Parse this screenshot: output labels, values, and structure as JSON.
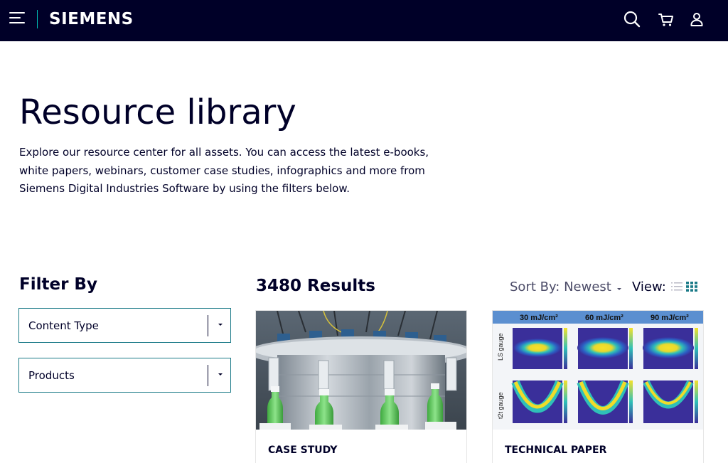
{
  "header": {
    "logo": "SIEMENS",
    "icons": [
      "menu-icon",
      "search-icon",
      "cart-icon",
      "user-icon"
    ],
    "background_color": "#000028",
    "accent_color": "#00c1b6"
  },
  "hero": {
    "title": "Resource library",
    "intro": "Explore our resource center for all assets. You can access the latest e-books, white papers, webinars, customer case studies, infographics and more from Siemens Digital Industries Software by using the filters below."
  },
  "filter": {
    "title": "Filter By",
    "content_type": "Content Type",
    "products": "Products",
    "border_color": "#1a7a87"
  },
  "results": {
    "count_label": "3480 Results",
    "sort_label": "Sort By: Newest",
    "view_label": "View:",
    "active_view_color": "#1a7a87"
  },
  "cards": [
    {
      "type": "CASE STUDY",
      "image": "bottle-filling-machine"
    },
    {
      "type": "TECHNICAL PAPER",
      "image": "heatmap-grid",
      "column_headers": [
        "30 mJ/cm²",
        "60 mJ/cm²",
        "90 mJ/cm²"
      ],
      "row_labels": [
        "LS gauge",
        "t2t gauge"
      ]
    }
  ]
}
